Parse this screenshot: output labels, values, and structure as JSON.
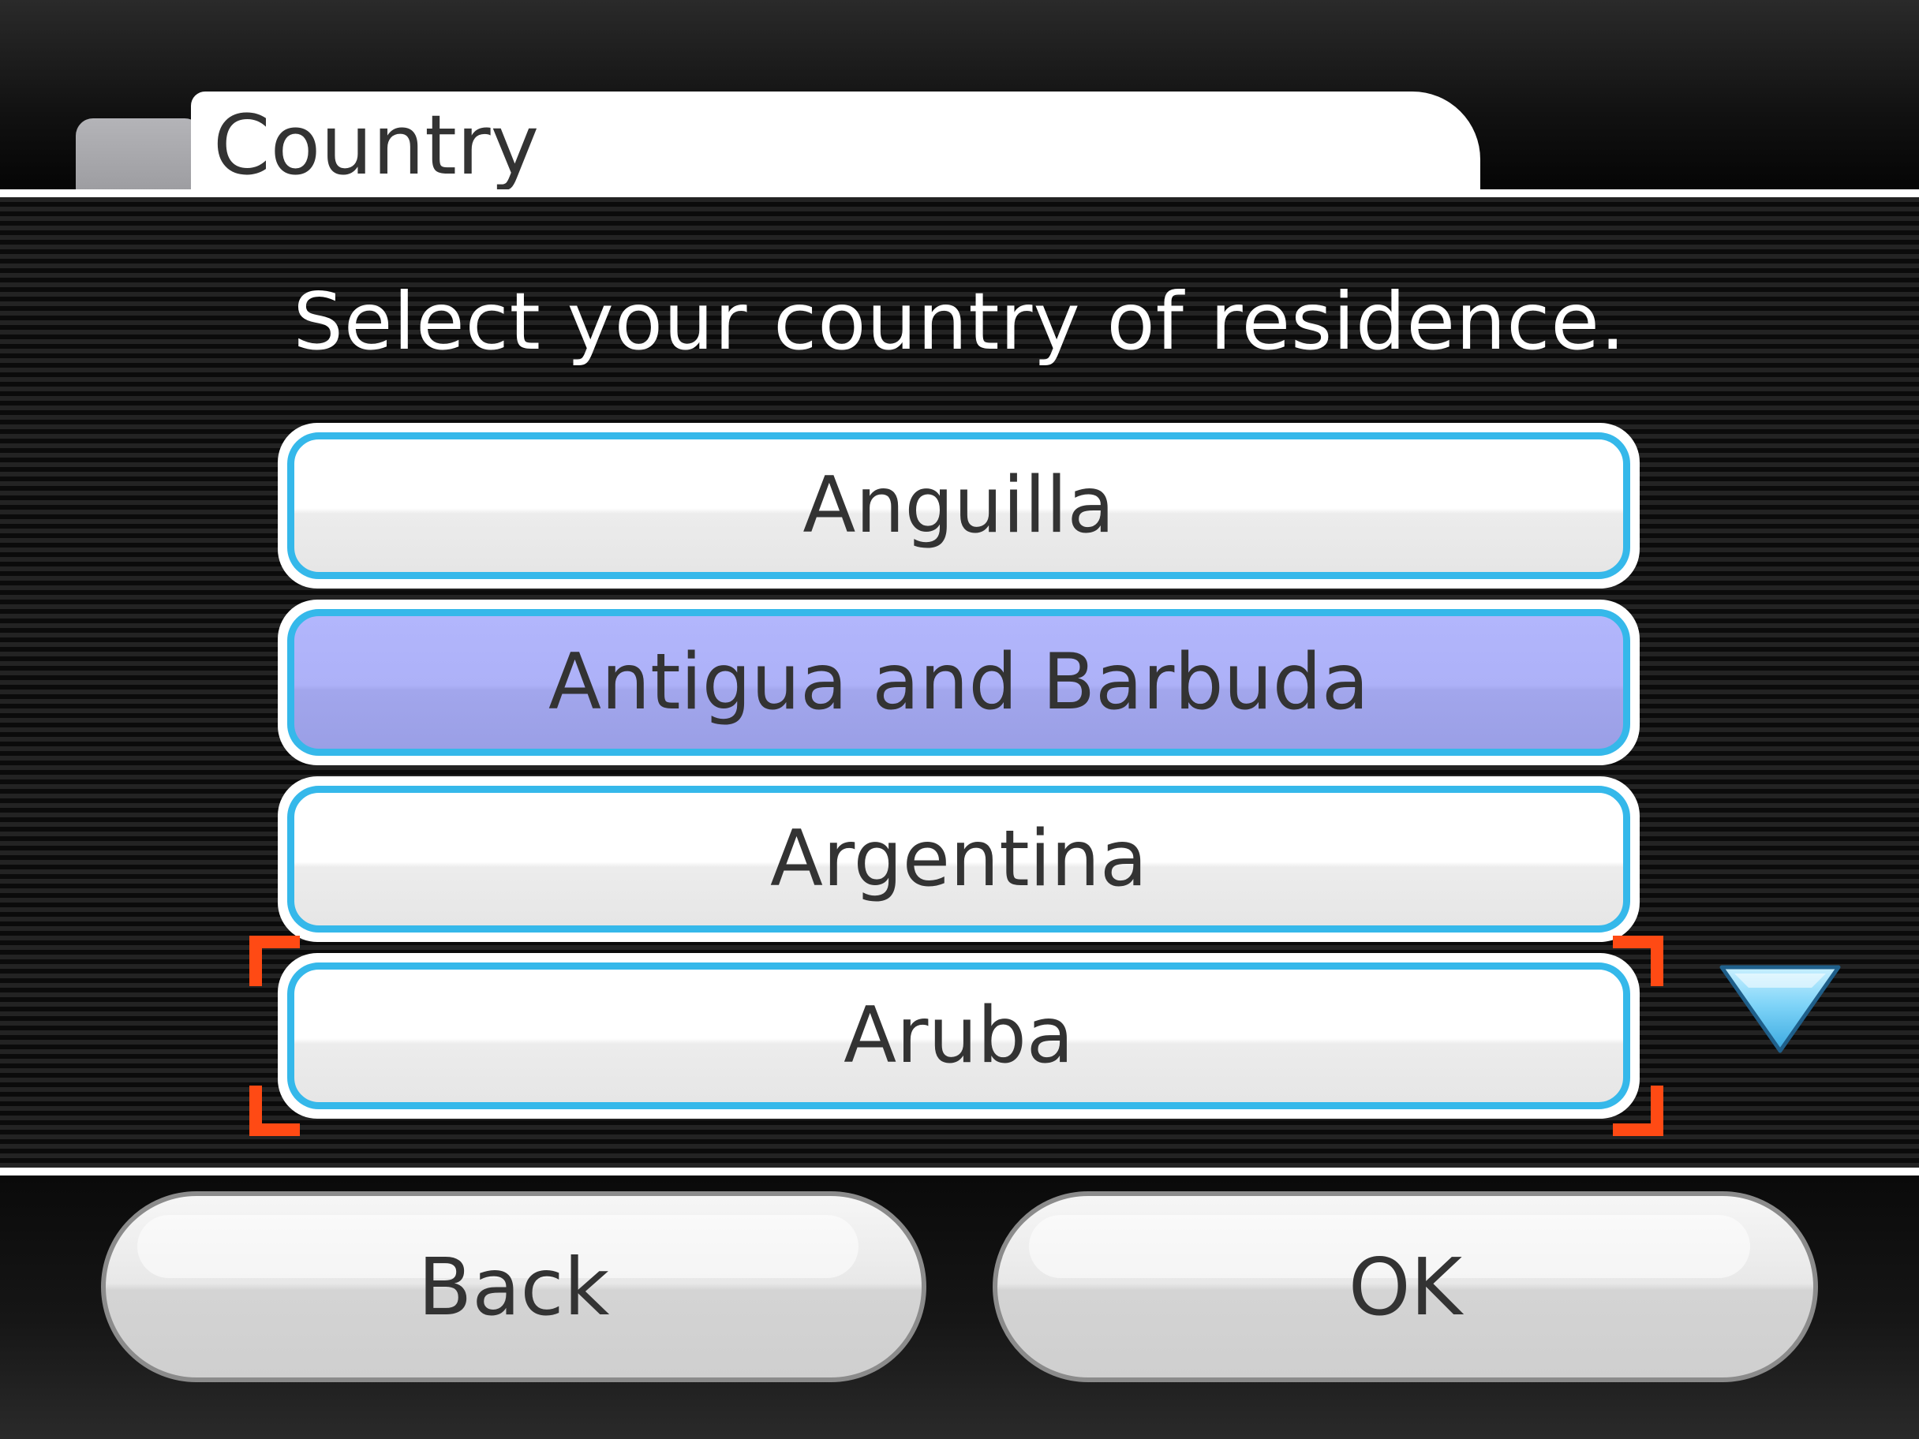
{
  "header": {
    "tab_title": "Country"
  },
  "instruction": "Select your country of residence.",
  "country_list": {
    "items": [
      {
        "label": "Anguilla",
        "selected": false
      },
      {
        "label": "Antigua and Barbuda",
        "selected": true
      },
      {
        "label": "Argentina",
        "selected": false
      },
      {
        "label": "Aruba",
        "selected": false
      }
    ],
    "cursor_on": "Aruba",
    "scroll_indicator_icon": "down-arrow-icon"
  },
  "footer": {
    "back_label": "Back",
    "ok_label": "OK"
  },
  "colors": {
    "item_border": "#35b8ea",
    "selected_fill": "#adb1f8",
    "cursor": "#ff4a14",
    "arrow": "#7fd4f8"
  }
}
